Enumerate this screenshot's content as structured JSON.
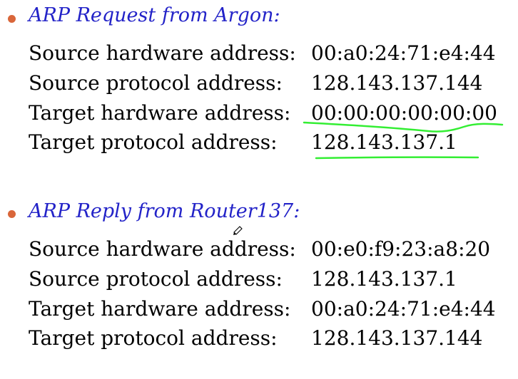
{
  "request": {
    "heading": "ARP Request from Argon:",
    "rows": [
      {
        "label": "Source hardware address:",
        "value": "00:a0:24:71:e4:44"
      },
      {
        "label": "Source protocol address:",
        "value": "128.143.137.144"
      },
      {
        "label": "Target hardware address:",
        "value": "00:00:00:00:00:00"
      },
      {
        "label": "Target protocol address:",
        "value": "128.143.137.1"
      }
    ]
  },
  "reply": {
    "heading": "ARP Reply from Router137:",
    "rows": [
      {
        "label": "Source hardware address:",
        "value": "00:e0:f9:23:a8:20"
      },
      {
        "label": "Source protocol address:",
        "value": "128.143.137.1"
      },
      {
        "label": "Target hardware address:",
        "value": "00:a0:24:71:e4:44"
      },
      {
        "label": "Target protocol address:",
        "value": "128.143.137.144"
      }
    ]
  },
  "colors": {
    "heading": "#2323c8",
    "bullet": "#d9663a",
    "highlight": "#33ee33"
  }
}
